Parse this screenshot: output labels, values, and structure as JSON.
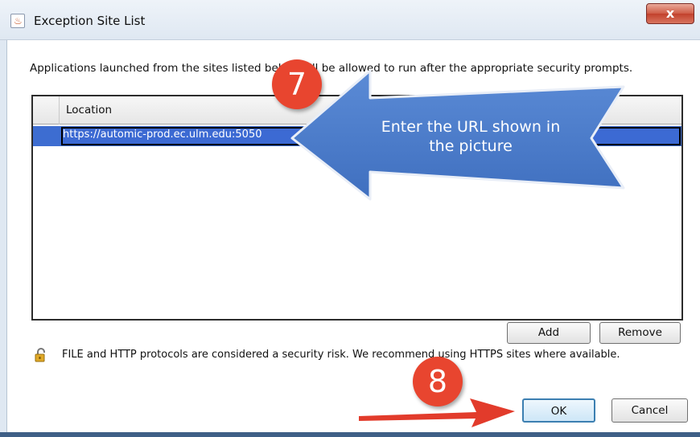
{
  "window": {
    "title": "Exception Site List",
    "close_label": "x"
  },
  "description": "Applications launched from the sites listed below will be allowed to run after the appropriate security prompts.",
  "table": {
    "column_header": "Location",
    "rows": [
      "https://automic-prod.ec.ulm.edu:5050"
    ]
  },
  "buttons": {
    "add": "Add",
    "remove": "Remove",
    "ok": "OK",
    "cancel": "Cancel"
  },
  "warning": "FILE and HTTP protocols are considered a security risk.  We recommend using HTTPS sites where available.",
  "annotations": {
    "step_7": "7",
    "step_8": "8",
    "callout_line1": "Enter the URL shown in",
    "callout_line2": "the picture"
  },
  "colors": {
    "callout_blue": "#4a7bc8",
    "badge_red": "#e8452f",
    "arrow_red": "#e23b2b",
    "selection_blue": "#3d6dd1"
  },
  "icons": {
    "app": "java-icon",
    "lock": "lock-icon",
    "close": "close-icon"
  }
}
